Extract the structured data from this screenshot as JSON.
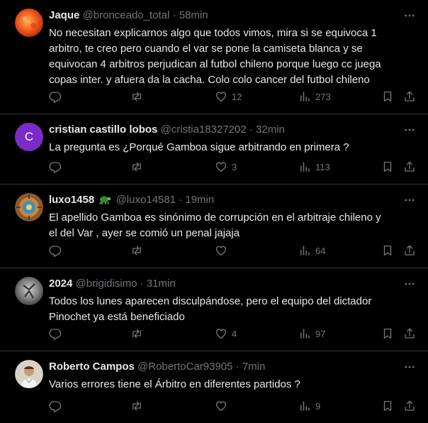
{
  "posts": [
    {
      "name": "Jaque",
      "handle": "@bronceado_total",
      "separator": "·",
      "time": "58min",
      "text": "No necesitan explicarnos algo que todos vimos, mira si se equivoca 1 arbitro, te creo pero cuando el var se pone la  camiseta blanca y se equivocan 4 arbitros perjudican al futbol chileno porque luego cc juega copas inter. y afuera da la cacha. Colo colo cancer del futbol chileno",
      "replies": "",
      "reposts": "",
      "likes": "12",
      "views": "273"
    },
    {
      "name": "cristian castillo lobos",
      "handle": "@cristia18327202",
      "separator": "·",
      "time": "32min",
      "avatar_letter": "C",
      "avatar_color": "#7b2cc7",
      "text": "La pregunta es ¿Porqué Gamboa sigue arbitrando en primera ?",
      "replies": "",
      "reposts": "",
      "likes": "3",
      "views": "113"
    },
    {
      "name": "luxo1458",
      "handle": "@luxo14581",
      "separator": "·",
      "time": "19min",
      "name_emoji": "turtle-icon",
      "text": "El apellido Gamboa es sinónimo de corrupción en el arbitraje chileno y el del Var , ayer se comió un penal jajaja",
      "replies": "",
      "reposts": "",
      "likes": "",
      "views": "64"
    },
    {
      "name": "2024",
      "handle": "@brigidisimo",
      "separator": "·",
      "time": "31min",
      "text": "Todos los lunes aparecen disculpándose, pero el equipo del dictador Pinochet ya está beneficiado",
      "replies": "",
      "reposts": "",
      "likes": "4",
      "views": "97"
    },
    {
      "name": "Roberto Campos",
      "handle": "@RobertoCar93905",
      "separator": "·",
      "time": "7min",
      "text": "Varios errores tiene el Árbitro en diferentes partidos ?",
      "replies": "",
      "reposts": "",
      "likes": "",
      "views": "9"
    }
  ],
  "colors": {
    "background": "#000000",
    "text": "#e7e9ea",
    "muted": "#71767b",
    "divider": "#2f3336"
  }
}
